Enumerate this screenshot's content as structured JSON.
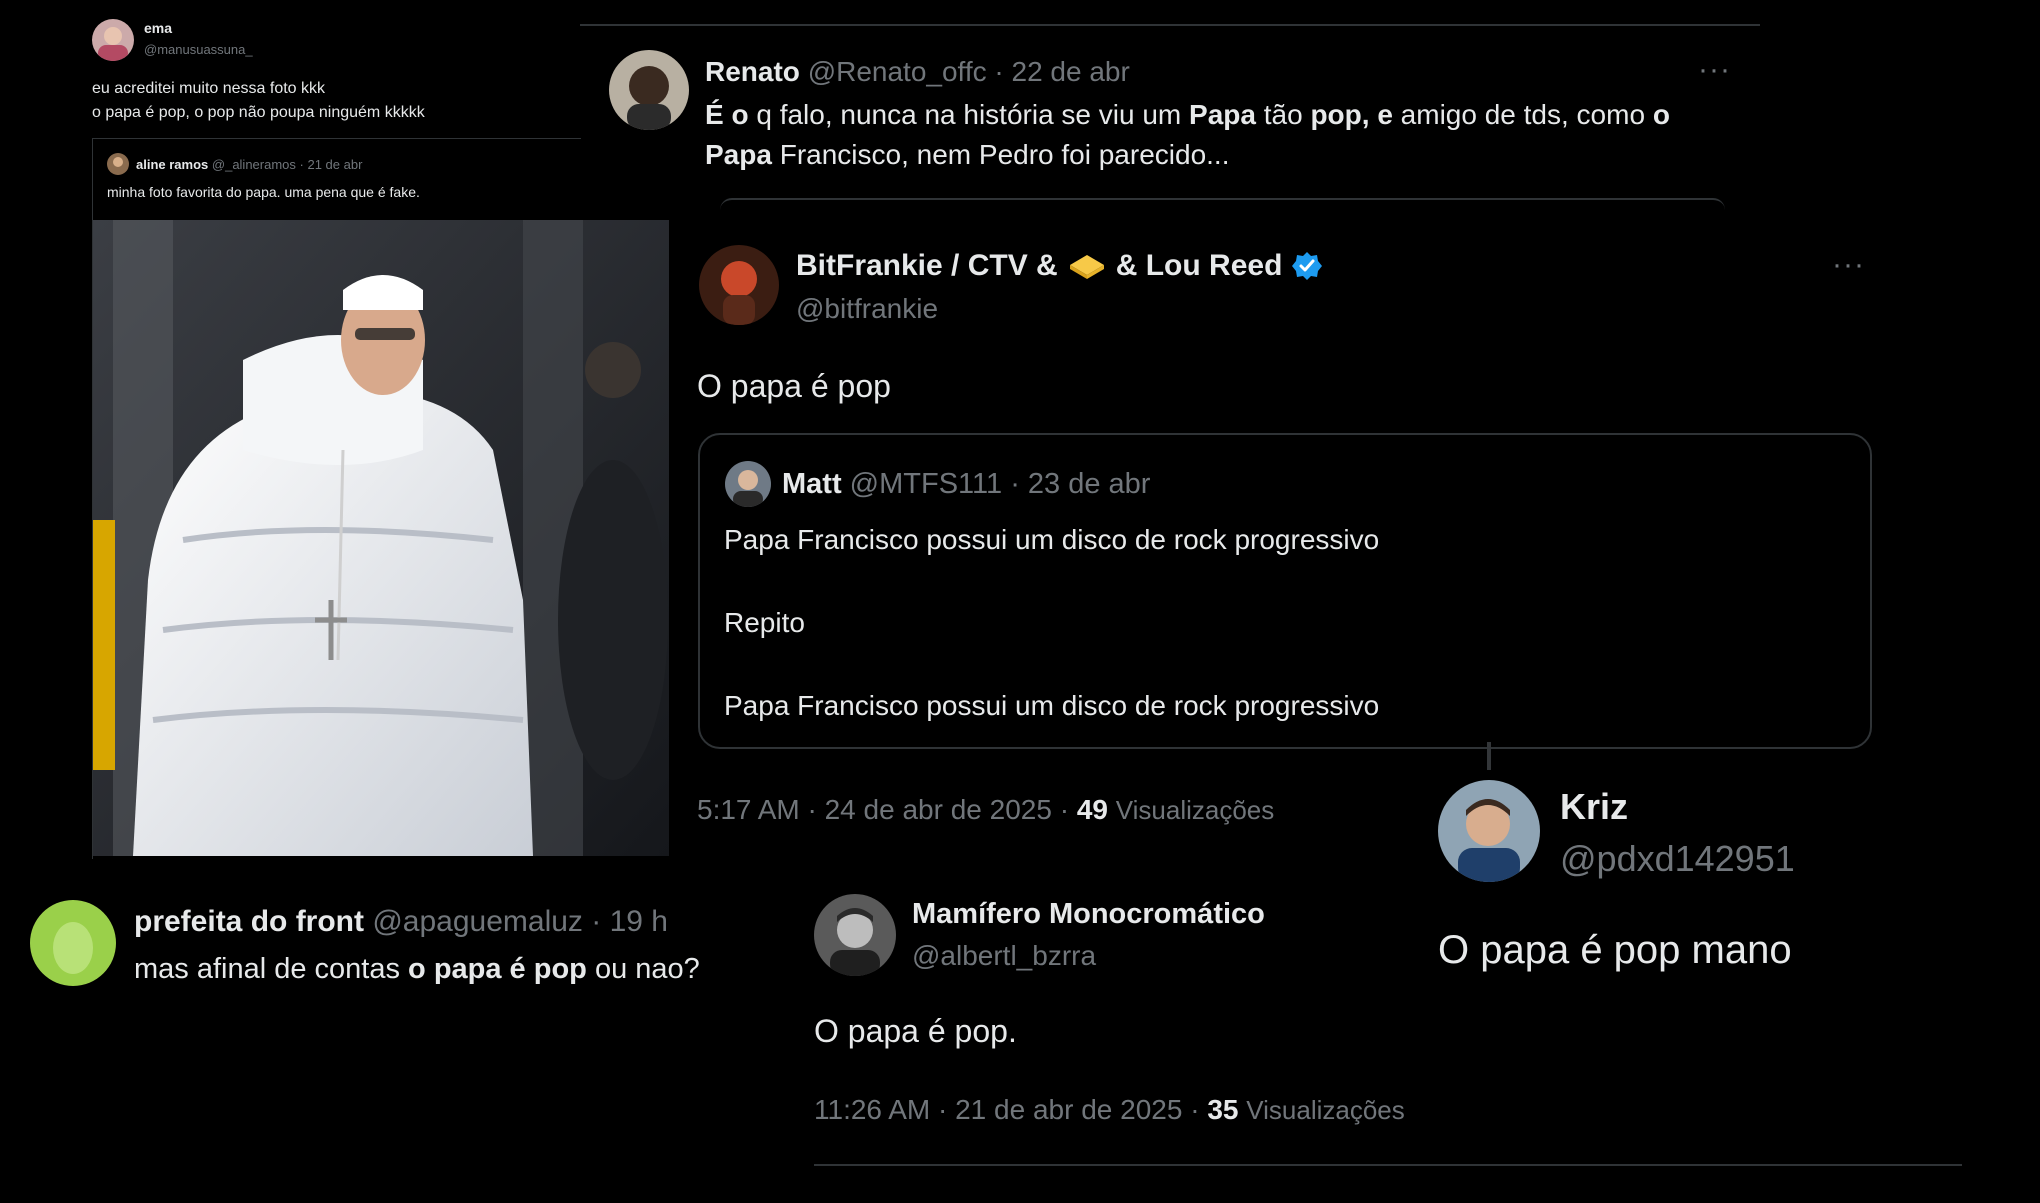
{
  "ema": {
    "name": "ema",
    "handle": "@manusuassuna_",
    "text_line1": "eu acreditei muito nessa foto kkk",
    "text_line2": "o papa é pop, o pop não poupa ninguém kkkkk",
    "quote": {
      "name": "aline ramos",
      "handle": "@_alineramos",
      "date": "· 21 de abr",
      "text": "minha foto favorita do papa. uma pena que é fake."
    }
  },
  "renato": {
    "name": "Renato",
    "handle": "@Renato_offc",
    "date": "· 22 de abr",
    "more": "···",
    "line1": {
      "s1": "É o",
      "s2": " q falo, nunca na história se viu um ",
      "s3": "Papa",
      "s4": " tão ",
      "s5": "pop",
      "s6": ", e",
      "s7": " amigo de tds, como ",
      "s8": "o"
    },
    "line2": {
      "s1": "Papa",
      "s2": " Francisco, nem Pedro foi parecido..."
    }
  },
  "bitfrankie": {
    "name_a": "BitFrankie / CTV &",
    "name_b": "& Lou Reed",
    "handle": "@bitfrankie",
    "more": "···",
    "text": "O papa é pop",
    "quote": {
      "name": "Matt",
      "handle": "@MTFS111",
      "date": "· 23 de abr",
      "line1": "Papa Francisco possui um disco de rock progressivo",
      "line2": "Repito",
      "line3": "Papa Francisco possui um disco de rock progressivo"
    },
    "time": "5:17 AM · 24 de abr de 2025 ·",
    "views_count": "49",
    "views_label": "Visualizações"
  },
  "kriz": {
    "name": "Kriz",
    "handle": "@pdxd142951",
    "text": "O papa é pop mano"
  },
  "prefeita": {
    "name": "prefeita do front",
    "handle": "@apaguemaluz",
    "date": "· 19 h",
    "text_a": "mas afinal de contas ",
    "text_b": "o papa é pop",
    "text_c": " ou nao?"
  },
  "mamifero": {
    "name": "Mamífero Monocromático",
    "handle": "@albertl_bzrra",
    "text": "O papa é pop.",
    "time": "11:26 AM · 21 de abr de 2025 ·",
    "views_count": "35",
    "views_label": "Visualizações"
  },
  "colors": {
    "background": "#000000",
    "text": "#e7e9ea",
    "muted": "#71767b",
    "verified": "#1d9bf0",
    "border": "#2f3336"
  }
}
